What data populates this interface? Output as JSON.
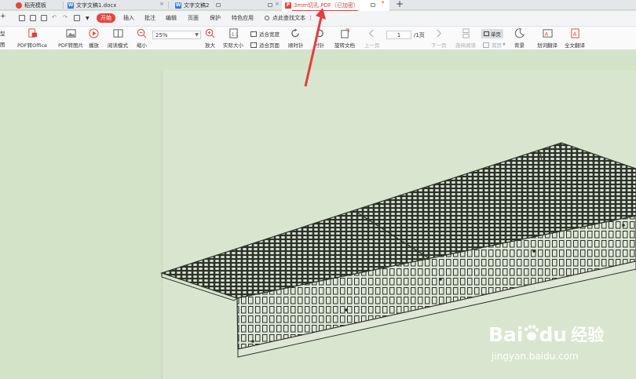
{
  "tabs": [
    {
      "label": "稻壳模板"
    },
    {
      "label": "文字文稿1.docx"
    },
    {
      "label": "文字文稿2"
    },
    {
      "label": "3mm切孔.PDF（已加密）"
    }
  ],
  "menu": {
    "items": [
      "开始",
      "插入",
      "批注",
      "编辑",
      "页面",
      "保护",
      "特色应用"
    ],
    "active": "开始",
    "search_label": "点此查找文本",
    "left_fragment": "+"
  },
  "ribbon": {
    "left_fragment_top": "型",
    "left_fragment_bottom": "图",
    "pdf_to_office": "PDF转Office",
    "pdf_to_image": "PDF转图片",
    "play": "播放",
    "read_mode": "阅读模式",
    "zoom_out": "缩小",
    "zoom_value": "25%",
    "zoom_in": "放大",
    "actual_size": "实际大小",
    "fit_width": "适合宽度",
    "fit_page": "适合页面",
    "rotate_cw": "顺时针",
    "rotate_ccw": "时针",
    "rotate_doc": "旋转文档",
    "prev_page": "上一页",
    "page_current": "1",
    "page_total": "/1页",
    "next_page": "下一页",
    "continuous_read": "连续阅读",
    "single_page": "单页",
    "double_page": "双页",
    "background": "背景",
    "translate_word": "划词翻译",
    "translate_full": "全文翻译"
  },
  "watermark": {
    "brand_left": "Bai",
    "brand_mid": "du",
    "brand_cn": "经验",
    "url": "jingyan.baidu.com"
  },
  "colors": {
    "accent_red": "#e9443c",
    "canvas_green": "#d2e3c8",
    "arrow_red": "#e53d3d"
  }
}
